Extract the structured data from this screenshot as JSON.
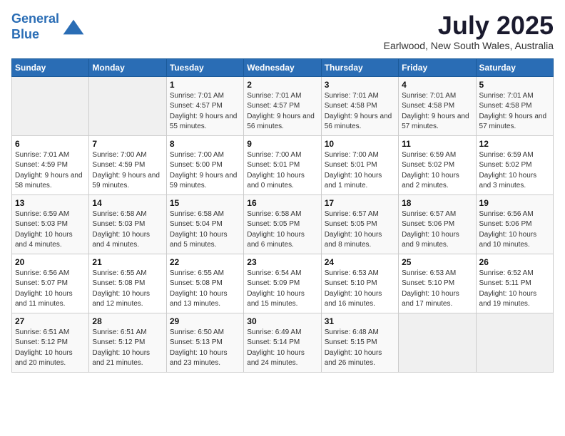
{
  "logo": {
    "line1": "General",
    "line2": "Blue"
  },
  "title": "July 2025",
  "location": "Earlwood, New South Wales, Australia",
  "days_header": [
    "Sunday",
    "Monday",
    "Tuesday",
    "Wednesday",
    "Thursday",
    "Friday",
    "Saturday"
  ],
  "weeks": [
    [
      {
        "day": "",
        "info": ""
      },
      {
        "day": "",
        "info": ""
      },
      {
        "day": "1",
        "info": "Sunrise: 7:01 AM\nSunset: 4:57 PM\nDaylight: 9 hours\nand 55 minutes."
      },
      {
        "day": "2",
        "info": "Sunrise: 7:01 AM\nSunset: 4:57 PM\nDaylight: 9 hours\nand 56 minutes."
      },
      {
        "day": "3",
        "info": "Sunrise: 7:01 AM\nSunset: 4:58 PM\nDaylight: 9 hours\nand 56 minutes."
      },
      {
        "day": "4",
        "info": "Sunrise: 7:01 AM\nSunset: 4:58 PM\nDaylight: 9 hours\nand 57 minutes."
      },
      {
        "day": "5",
        "info": "Sunrise: 7:01 AM\nSunset: 4:58 PM\nDaylight: 9 hours\nand 57 minutes."
      }
    ],
    [
      {
        "day": "6",
        "info": "Sunrise: 7:01 AM\nSunset: 4:59 PM\nDaylight: 9 hours\nand 58 minutes."
      },
      {
        "day": "7",
        "info": "Sunrise: 7:00 AM\nSunset: 4:59 PM\nDaylight: 9 hours\nand 59 minutes."
      },
      {
        "day": "8",
        "info": "Sunrise: 7:00 AM\nSunset: 5:00 PM\nDaylight: 9 hours\nand 59 minutes."
      },
      {
        "day": "9",
        "info": "Sunrise: 7:00 AM\nSunset: 5:01 PM\nDaylight: 10 hours\nand 0 minutes."
      },
      {
        "day": "10",
        "info": "Sunrise: 7:00 AM\nSunset: 5:01 PM\nDaylight: 10 hours\nand 1 minute."
      },
      {
        "day": "11",
        "info": "Sunrise: 6:59 AM\nSunset: 5:02 PM\nDaylight: 10 hours\nand 2 minutes."
      },
      {
        "day": "12",
        "info": "Sunrise: 6:59 AM\nSunset: 5:02 PM\nDaylight: 10 hours\nand 3 minutes."
      }
    ],
    [
      {
        "day": "13",
        "info": "Sunrise: 6:59 AM\nSunset: 5:03 PM\nDaylight: 10 hours\nand 4 minutes."
      },
      {
        "day": "14",
        "info": "Sunrise: 6:58 AM\nSunset: 5:03 PM\nDaylight: 10 hours\nand 4 minutes."
      },
      {
        "day": "15",
        "info": "Sunrise: 6:58 AM\nSunset: 5:04 PM\nDaylight: 10 hours\nand 5 minutes."
      },
      {
        "day": "16",
        "info": "Sunrise: 6:58 AM\nSunset: 5:05 PM\nDaylight: 10 hours\nand 6 minutes."
      },
      {
        "day": "17",
        "info": "Sunrise: 6:57 AM\nSunset: 5:05 PM\nDaylight: 10 hours\nand 8 minutes."
      },
      {
        "day": "18",
        "info": "Sunrise: 6:57 AM\nSunset: 5:06 PM\nDaylight: 10 hours\nand 9 minutes."
      },
      {
        "day": "19",
        "info": "Sunrise: 6:56 AM\nSunset: 5:06 PM\nDaylight: 10 hours\nand 10 minutes."
      }
    ],
    [
      {
        "day": "20",
        "info": "Sunrise: 6:56 AM\nSunset: 5:07 PM\nDaylight: 10 hours\nand 11 minutes."
      },
      {
        "day": "21",
        "info": "Sunrise: 6:55 AM\nSunset: 5:08 PM\nDaylight: 10 hours\nand 12 minutes."
      },
      {
        "day": "22",
        "info": "Sunrise: 6:55 AM\nSunset: 5:08 PM\nDaylight: 10 hours\nand 13 minutes."
      },
      {
        "day": "23",
        "info": "Sunrise: 6:54 AM\nSunset: 5:09 PM\nDaylight: 10 hours\nand 15 minutes."
      },
      {
        "day": "24",
        "info": "Sunrise: 6:53 AM\nSunset: 5:10 PM\nDaylight: 10 hours\nand 16 minutes."
      },
      {
        "day": "25",
        "info": "Sunrise: 6:53 AM\nSunset: 5:10 PM\nDaylight: 10 hours\nand 17 minutes."
      },
      {
        "day": "26",
        "info": "Sunrise: 6:52 AM\nSunset: 5:11 PM\nDaylight: 10 hours\nand 19 minutes."
      }
    ],
    [
      {
        "day": "27",
        "info": "Sunrise: 6:51 AM\nSunset: 5:12 PM\nDaylight: 10 hours\nand 20 minutes."
      },
      {
        "day": "28",
        "info": "Sunrise: 6:51 AM\nSunset: 5:12 PM\nDaylight: 10 hours\nand 21 minutes."
      },
      {
        "day": "29",
        "info": "Sunrise: 6:50 AM\nSunset: 5:13 PM\nDaylight: 10 hours\nand 23 minutes."
      },
      {
        "day": "30",
        "info": "Sunrise: 6:49 AM\nSunset: 5:14 PM\nDaylight: 10 hours\nand 24 minutes."
      },
      {
        "day": "31",
        "info": "Sunrise: 6:48 AM\nSunset: 5:15 PM\nDaylight: 10 hours\nand 26 minutes."
      },
      {
        "day": "",
        "info": ""
      },
      {
        "day": "",
        "info": ""
      }
    ]
  ]
}
